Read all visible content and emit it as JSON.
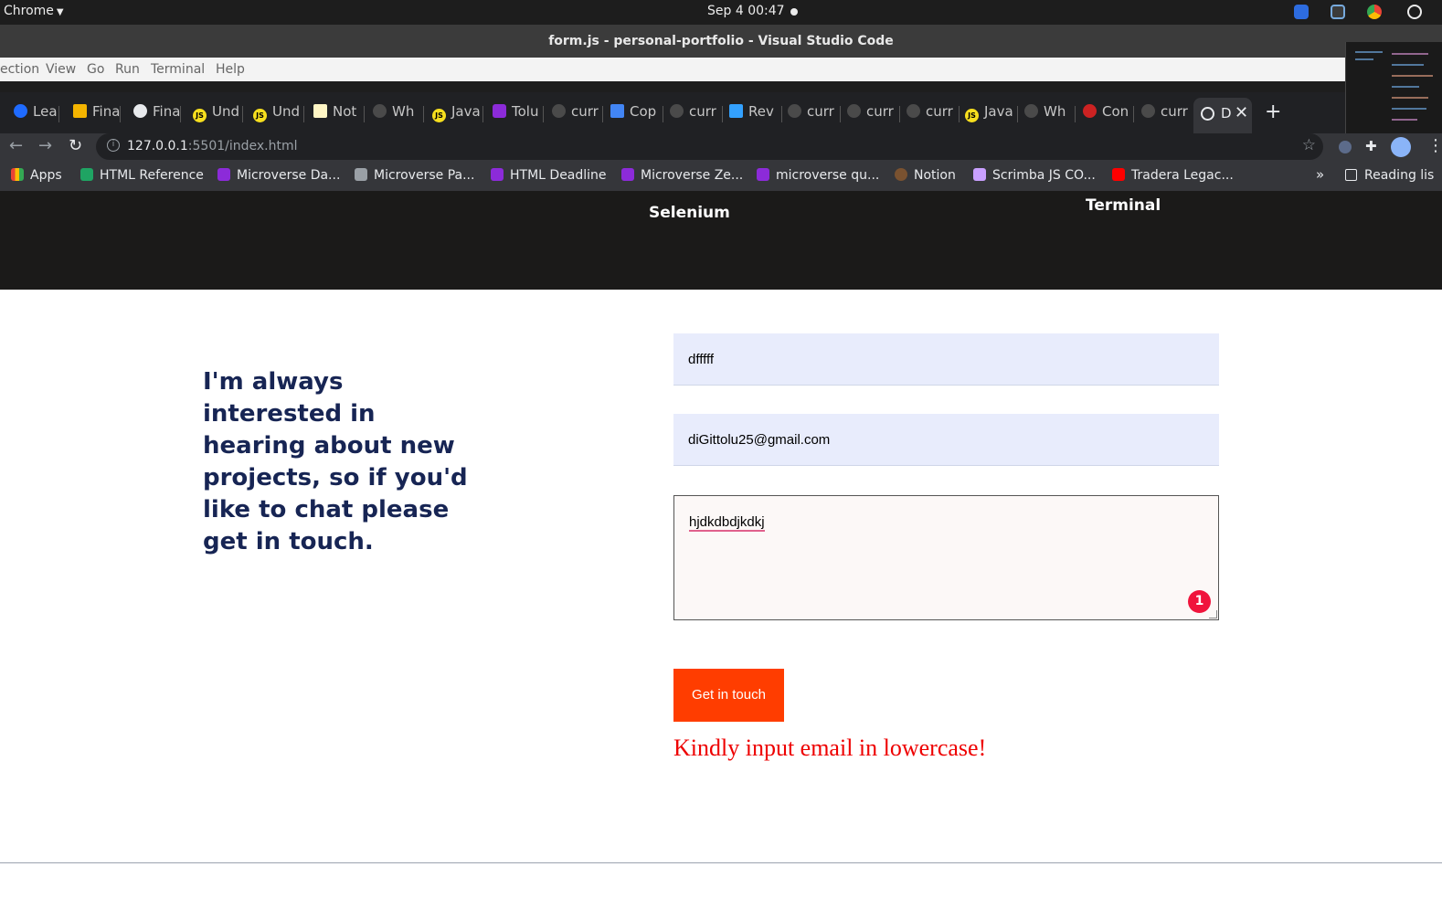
{
  "system_bar": {
    "app_name": "Chrome",
    "clock": "Sep 4  00:47"
  },
  "vscode": {
    "window_title": "form.js - personal-portfolio - Visual Studio Code",
    "menu": [
      "ection",
      "View",
      "Go",
      "Run",
      "Terminal",
      "Help"
    ]
  },
  "browser": {
    "tabs": [
      {
        "label": "Lea",
        "icon": "coursera-icon",
        "color": "#1f6bff"
      },
      {
        "label": "Fina",
        "icon": "slides-icon",
        "color": "#f4b400"
      },
      {
        "label": "Fina",
        "icon": "globe-icon",
        "color": "#e8eaed"
      },
      {
        "label": "Und",
        "icon": "js-icon",
        "color": "#f7df1e"
      },
      {
        "label": "Und",
        "icon": "js-icon",
        "color": "#f7df1e"
      },
      {
        "label": "Not",
        "icon": "notes-icon",
        "color": "#fff6c5"
      },
      {
        "label": "Wh",
        "icon": "github-icon",
        "color": "#4a4a4a"
      },
      {
        "label": "Java",
        "icon": "js-icon",
        "color": "#f7df1e"
      },
      {
        "label": "Tolu",
        "icon": "microverse-icon",
        "color": "#8c2bd9"
      },
      {
        "label": "curr",
        "icon": "github-icon",
        "color": "#4a4a4a"
      },
      {
        "label": "Cop",
        "icon": "docs-icon",
        "color": "#4285f4"
      },
      {
        "label": "curr",
        "icon": "github-icon",
        "color": "#4a4a4a"
      },
      {
        "label": "Rev",
        "icon": "cube-icon",
        "color": "#33a1ff"
      },
      {
        "label": "curr",
        "icon": "github-icon",
        "color": "#4a4a4a"
      },
      {
        "label": "curr",
        "icon": "github-icon",
        "color": "#4a4a4a"
      },
      {
        "label": "curr",
        "icon": "github-icon",
        "color": "#4a4a4a"
      },
      {
        "label": "Java",
        "icon": "js-icon",
        "color": "#f7df1e"
      },
      {
        "label": "Wh",
        "icon": "github-icon",
        "color": "#4a4a4a"
      },
      {
        "label": "Con",
        "icon": "github-icon",
        "color": "#cc2222"
      },
      {
        "label": "curr",
        "icon": "github-icon",
        "color": "#4a4a4a"
      }
    ],
    "active_tab": {
      "label": "D",
      "icon": "globe-icon"
    },
    "url_host": "127.0.0.1",
    "url_rest": ":5501/index.html",
    "bookmarks": [
      {
        "label": "Apps",
        "icon": "apps-grid-icon",
        "color": "#4285f4"
      },
      {
        "label": "HTML Reference",
        "icon": "w-icon",
        "color": "#1fa463"
      },
      {
        "label": "Microverse Da...",
        "icon": "microverse-icon",
        "color": "#8c2bd9"
      },
      {
        "label": "Microverse Pa...",
        "icon": "microverse-icon",
        "color": "#9aa0a6"
      },
      {
        "label": "HTML Deadline",
        "icon": "microverse-icon",
        "color": "#8c2bd9"
      },
      {
        "label": "Microverse Ze...",
        "icon": "microverse-icon",
        "color": "#8c2bd9"
      },
      {
        "label": "microverse qu...",
        "icon": "microverse-icon",
        "color": "#8c2bd9"
      },
      {
        "label": "Notion",
        "icon": "avatar-icon",
        "color": "#7a5230"
      },
      {
        "label": "Scrimba JS CO...",
        "icon": "scrimba-icon",
        "color": "#c9a0ff"
      },
      {
        "label": "Tradera Legac...",
        "icon": "youtube-icon",
        "color": "#ff0000"
      }
    ],
    "more": "»",
    "reading_list": "Reading lis"
  },
  "page": {
    "hero_left": "Selenium",
    "hero_right": "Terminal",
    "intro": "I'm always interested in hearing about new projects, so if you'd like to chat please get in touch.",
    "name_value": "dfffff",
    "email_value": "diGittolu25@gmail.com",
    "message_value": "hjdkdbdjkdkj",
    "badge_count": "1",
    "submit_label": "Get in touch",
    "error_message": "Kindly input email in lowercase!",
    "colors": {
      "accent": "#ff3d00",
      "error": "#ee0000",
      "heading": "#172554",
      "field_bg": "#e8ecfc"
    }
  }
}
